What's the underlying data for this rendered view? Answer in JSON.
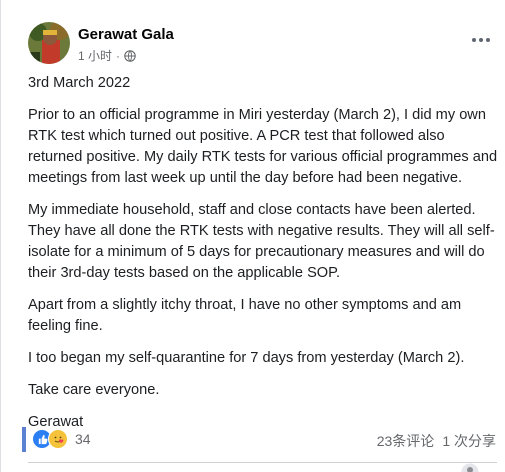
{
  "post": {
    "author": "Gerawat Gala",
    "time": "1 小时",
    "separator": "·",
    "paragraphs": [
      "3rd March 2022",
      "Prior to an official programme in Miri yesterday (March 2), I did my own RTK test which turned out positive. A PCR test that followed also returned positive. My daily RTK tests for various official programmes and meetings from last week up until the day before had been negative.",
      "My immediate household, staff and close contacts have been alerted. They have all done the RTK tests with negative results. They will all self-isolate for a minimum of 5 days for precautionary measures and will do their 3rd-day tests based on the applicable SOP.",
      "Apart from a slightly itchy throat, I have no other symptoms and am feeling fine.",
      "I too began my self-quarantine for 7 days from yesterday (March 2).",
      "Take care everyone.",
      "Gerawat"
    ]
  },
  "reactions": {
    "count": "34",
    "comments": "23条评论",
    "shares": "1 次分享",
    "icons": [
      "like-icon",
      "care-icon"
    ]
  },
  "colors": {
    "like": "#2c7ff2",
    "care": "#f5c33b",
    "meta": "#65676b"
  }
}
